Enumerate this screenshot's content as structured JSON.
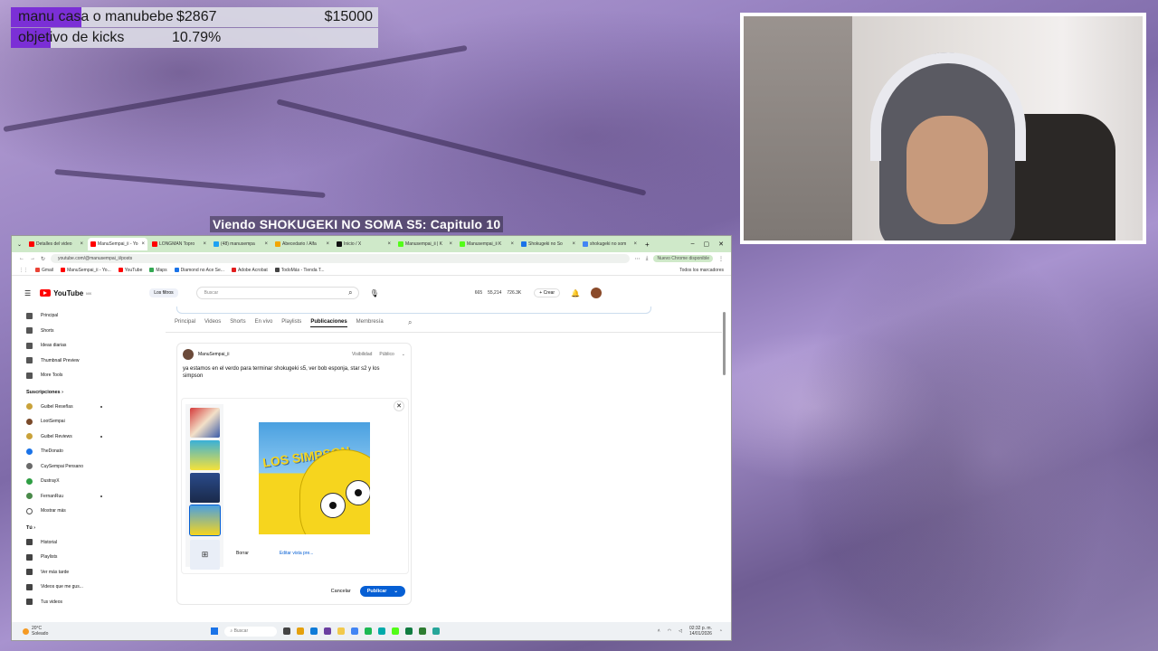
{
  "overlay": {
    "goal1": {
      "label": "manu casa o manubebe",
      "current": "$2867",
      "target": "$15000",
      "progress": 0.191
    },
    "goal2": {
      "label": "objetivo de kicks",
      "percent": "10.79%",
      "progress": 0.1079
    },
    "now_watching": "Viendo SHOKUGEKI NO SOMA S5: Capitulo 10"
  },
  "browser": {
    "tabs": [
      {
        "label": "Detalles del video",
        "color": "#ff0000"
      },
      {
        "label": "ManuSempai_ii - Yo",
        "color": "#ff0000",
        "active": true
      },
      {
        "label": "LONGMAN Topro",
        "color": "#ff0000"
      },
      {
        "label": "(48) manusempa",
        "color": "#1da1f2"
      },
      {
        "label": "Abecedario / Alfa",
        "color": "#f2a600"
      },
      {
        "label": "Inicio / X",
        "color": "#111111"
      },
      {
        "label": "Manusempai_ii | K",
        "color": "#53fc18"
      },
      {
        "label": "Manusempai_ii K",
        "color": "#53fc18"
      },
      {
        "label": "Shokugeki no So",
        "color": "#1a73e8"
      },
      {
        "label": "shokugeki no som",
        "color": "#4285f4"
      }
    ],
    "url": "youtube.com/@manusempai_ii/posts",
    "chrome_badge": "Nuevo Chrome disponible",
    "bookmarks": [
      {
        "label": "Gmail",
        "color": "#ea4335"
      },
      {
        "label": "ManuSempai_ii - Yo...",
        "color": "#ff0000"
      },
      {
        "label": "YouTube",
        "color": "#ff0000"
      },
      {
        "label": "Maps",
        "color": "#34a853"
      },
      {
        "label": "Diamond no Ace Se...",
        "color": "#1a73e8"
      },
      {
        "label": "Adobe Acrobat",
        "color": "#e21d1d"
      },
      {
        "label": "TodoMás - Tienda T...",
        "color": "#444444"
      }
    ],
    "all_bookmarks": "Todos los marcadores"
  },
  "youtube": {
    "logo_text": "YouTube",
    "logo_country": "MX",
    "filters": "Los filtros",
    "search_placeholder": "Buscar",
    "stats": [
      "665",
      "55,214",
      "726.3K"
    ],
    "create": "Crear",
    "sidebar_main": [
      {
        "label": "Principal"
      },
      {
        "label": "Shorts"
      },
      {
        "label": "Ideas diarias"
      },
      {
        "label": "Thumbnail Preview"
      },
      {
        "label": "More Tools"
      }
    ],
    "subs_header": "Suscripciones",
    "subs": [
      {
        "label": "Guibel Reseñas",
        "color": "#c9a23a",
        "live": true
      },
      {
        "label": "LootSempai",
        "color": "#7a4a2a",
        "live": false
      },
      {
        "label": "Guibel Reviews",
        "color": "#c9a23a",
        "live": true
      },
      {
        "label": "TheDonato",
        "color": "#1a73e8",
        "live": false
      },
      {
        "label": "CuySempai Pensano",
        "color": "#6a6a6a",
        "live": false
      },
      {
        "label": "DustrayX",
        "color": "#2f9e44",
        "live": false
      },
      {
        "label": "FernanRuu",
        "color": "#4a8a4a",
        "live": true
      },
      {
        "label": "Mostrar más",
        "color": "#ffffff",
        "live": false
      }
    ],
    "you_header": "Tú",
    "you_items": [
      {
        "label": "Historial"
      },
      {
        "label": "Playlists"
      },
      {
        "label": "Ver más tarde"
      },
      {
        "label": "Videos que me gus..."
      },
      {
        "label": "Tus videos"
      }
    ],
    "channel_tabs": [
      "Principal",
      "Videos",
      "Shorts",
      "En vivo",
      "Playlists",
      "Publicaciones",
      "Membresía"
    ],
    "active_tab": "Publicaciones",
    "post": {
      "author": "ManuSempai_ii",
      "visibility_label": "Visibilidad",
      "visibility_value": "Público",
      "text": "ya estamos en el verdo para terminar shokugeki s5, ver bob esponja, star s2 y los simpson",
      "preview_title": "LOS SIMPSON",
      "delete": "Borrar",
      "edit_preview": "Editar vista pre...",
      "cancel": "Cancelar",
      "publish": "Publicar"
    }
  },
  "taskbar": {
    "weather_temp": "20°C",
    "weather_desc": "Soleado",
    "search": "Buscar",
    "time": "02:32 p. m.",
    "date": "14/01/2026"
  }
}
